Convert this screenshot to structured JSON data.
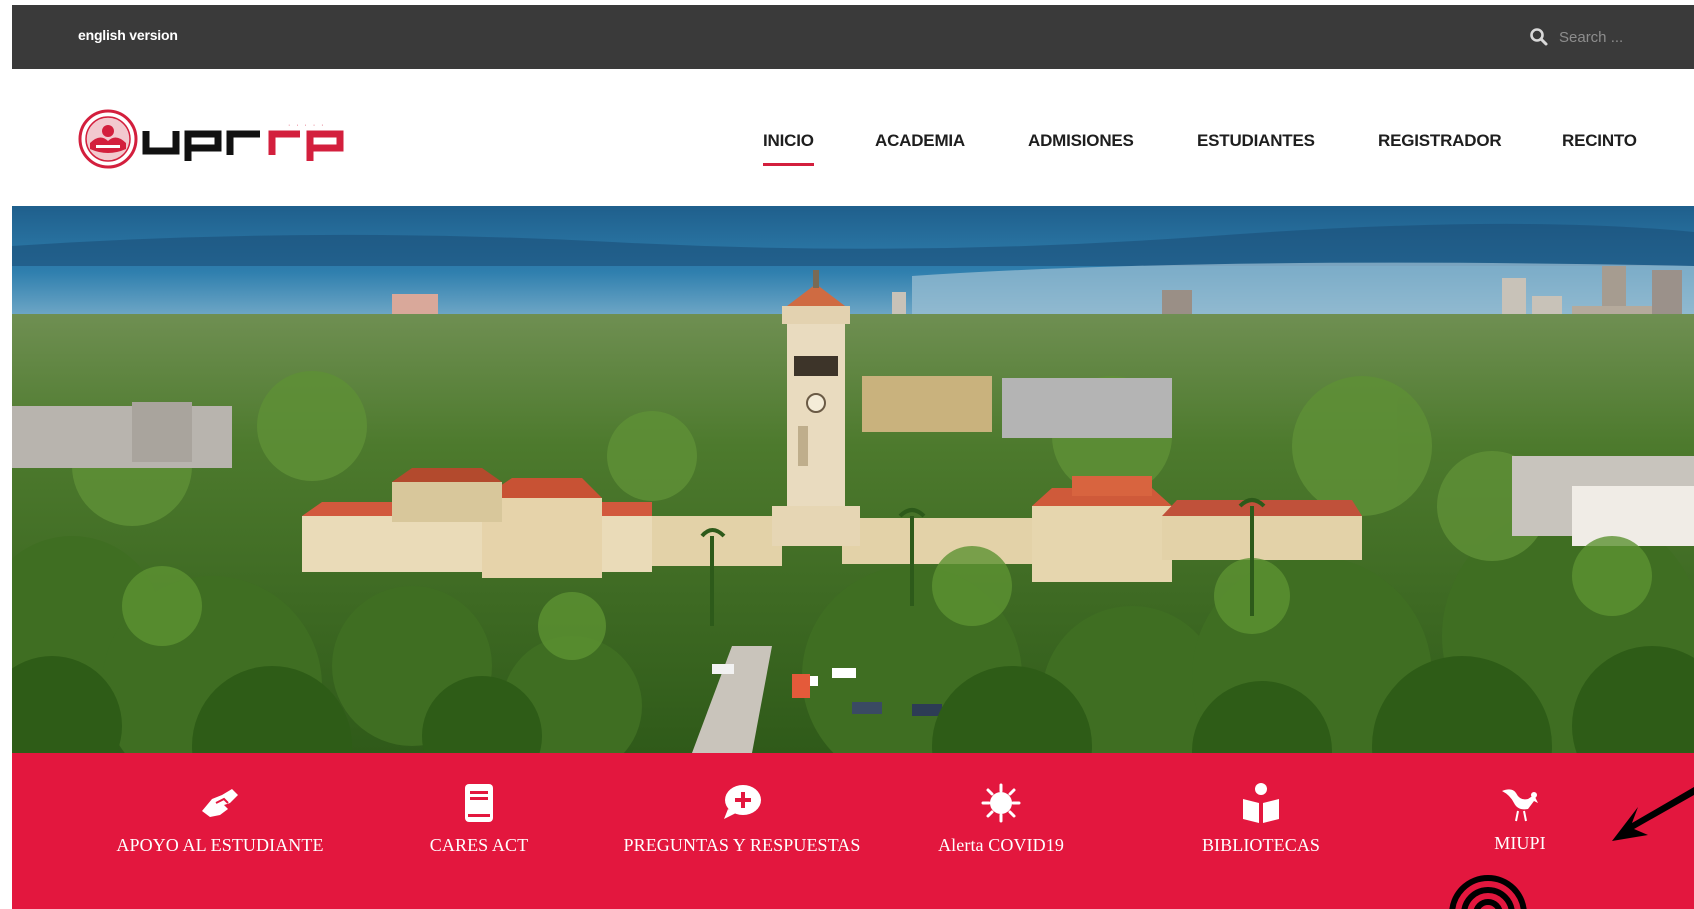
{
  "topbar": {
    "language_link": "english version",
    "search_placeholder": "Search ..."
  },
  "header": {
    "logo_text": "uprrp",
    "nav": [
      {
        "label": "INICIO",
        "active": true
      },
      {
        "label": "ACADEMIA",
        "active": false
      },
      {
        "label": "ADMISIONES",
        "active": false
      },
      {
        "label": "ESTUDIANTES",
        "active": false
      },
      {
        "label": "REGISTRADOR",
        "active": false
      },
      {
        "label": "RECINTO",
        "active": false
      }
    ]
  },
  "quick_links": [
    {
      "label": "APOYO AL ESTUDIANTE",
      "icon": "handshake-icon"
    },
    {
      "label": "CARES ACT",
      "icon": "book-icon"
    },
    {
      "label": "PREGUNTAS Y RESPUESTAS",
      "icon": "question-chat-icon"
    },
    {
      "label": "Alerta COVID19",
      "icon": "virus-icon"
    },
    {
      "label": "BIBLIOTECAS",
      "icon": "reader-icon"
    },
    {
      "label": "MIUPI",
      "icon": "rooster-icon"
    }
  ],
  "colors": {
    "topbar": "#3a3a3a",
    "accent": "#e3173e",
    "active_underline": "#d31f3d"
  }
}
